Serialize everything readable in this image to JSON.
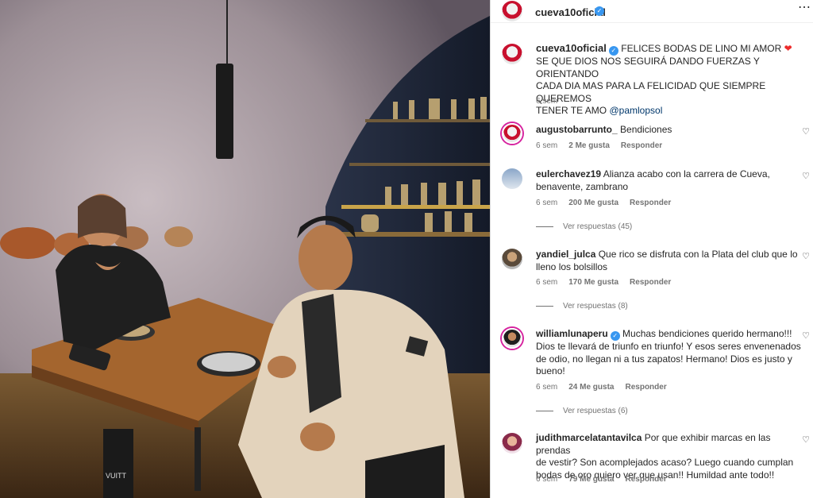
{
  "post": {
    "author": "cueva10oficial",
    "verified": true,
    "caption_lines": [
      "FELICES BODAS DE LINO MI AMOR",
      "SE QUE DIOS NOS SEGUIRÁ DANDO FUERZAS Y ORIENTANDO",
      "CADA DIA MAS PARA LA FELICIDAD QUE SIEMPRE QUEREMOS",
      "TENER TE AMO"
    ],
    "caption_emoji": "❤",
    "caption_mention": "@pamlopsol",
    "caption_time": "6 sem"
  },
  "photo": {
    "sign_text": "VUITT",
    "description_icon": "photo-image"
  },
  "comments": [
    {
      "user": "augustobarrunto_",
      "lines": [
        "Bendiciones"
      ],
      "time": "6 sem",
      "likes": "2 Me gusta",
      "reply": "Responder",
      "view_replies": ""
    },
    {
      "user": "eulerchavez19",
      "lines": [
        "Alianza acabo con la carrera de Cueva,",
        "benavente, zambrano"
      ],
      "time": "6 sem",
      "likes": "200 Me gusta",
      "reply": "Responder",
      "view_replies": "Ver respuestas (45)"
    },
    {
      "user": "yandiel_julca",
      "lines": [
        "Que rico se disfruta con la Plata del club que lo",
        "lleno los bolsillos"
      ],
      "time": "6 sem",
      "likes": "170 Me gusta",
      "reply": "Responder",
      "view_replies": "Ver respuestas (8)"
    },
    {
      "user": "williamlunaperu",
      "verified": true,
      "lines": [
        "Muchas bendiciones querido hermano!!!",
        "Dios te llevará de triunfo en triunfo! Y esos seres envenenados",
        "de odio, no llegan ni a tus zapatos! Hermano! Dios es justo y",
        "bueno!"
      ],
      "time": "6 sem",
      "likes": "24 Me gusta",
      "reply": "Responder",
      "view_replies": "Ver respuestas (6)"
    },
    {
      "user": "judithmarcelatantavilca",
      "lines": [
        "Por que exhibir marcas en las prendas",
        "de vestir? Son acomplejados acaso? Luego cuando cumplan",
        "bodas de oro quiero ver que usan!! Humildad ante todo!!"
      ],
      "time": "6 sem",
      "likes": "79 Me gusta",
      "reply": "Responder",
      "view_replies": ""
    }
  ],
  "colors": {
    "verified": "#3897f0",
    "heart": "#ed2b2b",
    "mention": "#00376b",
    "muted": "#737373"
  }
}
